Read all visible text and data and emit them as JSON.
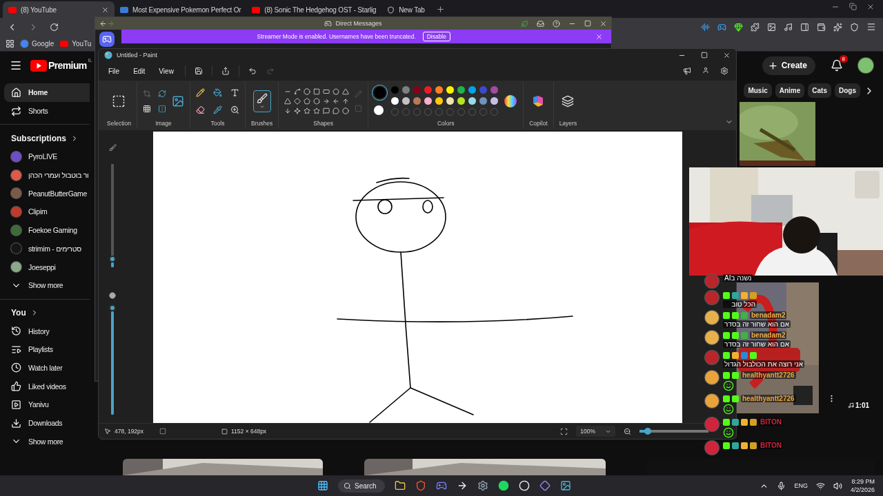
{
  "browser": {
    "tabs": [
      {
        "title": "(8) YouTube",
        "selected": true
      },
      {
        "title": "Most Expensive Pokemon Perfect Or",
        "selected": false
      },
      {
        "title": "(8) Sonic The Hedgehog OST - Starlig",
        "selected": false
      },
      {
        "title": "New Tab",
        "selected": false
      }
    ],
    "bookmarks": [
      "Google",
      "YouTu"
    ]
  },
  "youtube": {
    "logo": "Premium",
    "country": "IL",
    "create": "Create",
    "notifications": "8",
    "nav": [
      {
        "label": "Home",
        "selected": true
      },
      {
        "label": "Shorts",
        "selected": false
      }
    ],
    "subscriptions_title": "Subscriptions",
    "subscriptions": [
      {
        "name": "PyroLIVE",
        "color": "#6b4fc8"
      },
      {
        "name": "ור בוטבול ועמרי הכהן",
        "color": "#e0584a"
      },
      {
        "name": "PeanutButterGame",
        "color": "#7a5a48"
      },
      {
        "name": "Clipim",
        "color": "#c0392b"
      },
      {
        "name": "Foekoe Gaming",
        "color": "#3d6b3a"
      },
      {
        "name": "סטרימים - strimim",
        "color": "#161616"
      },
      {
        "name": "Joeseppi",
        "color": "#8aa88a"
      }
    ],
    "subscriptions_more": "Show more",
    "you_title": "You",
    "you": [
      "History",
      "Playlists",
      "Watch later",
      "Liked videos",
      "Yanivu",
      "Downloads"
    ],
    "you_more": "Show more",
    "chips": [
      "Music",
      "Anime",
      "Cats",
      "Dogs"
    ],
    "duration": "1:01"
  },
  "discord": {
    "title": "Direct Messages",
    "banner": "Streamer Mode is enabled. Usernames have been truncated.",
    "banner_button": "Disable"
  },
  "paint": {
    "title": "Untitled - Paint",
    "menu": [
      "File",
      "Edit",
      "View"
    ],
    "groups": {
      "selection": "Selection",
      "image": "Image",
      "tools": "Tools",
      "brushes": "Brushes",
      "shapes": "Shapes",
      "colors": "Colors",
      "copilot": "Copilot",
      "layers": "Layers"
    },
    "current_colors": [
      {
        "color": "#000000",
        "selected": true
      },
      {
        "color": "#ffffff",
        "selected": false
      }
    ],
    "colors": [
      {
        "color": "#000000"
      },
      {
        "color": "#7f7f7f"
      },
      {
        "color": "#880015"
      },
      {
        "color": "#ed1c24"
      },
      {
        "color": "#ff7f27"
      },
      {
        "color": "#fff200"
      },
      {
        "color": "#22b14c"
      },
      {
        "color": "#00a2e8"
      },
      {
        "color": "#3f48cc"
      },
      {
        "color": "#a349a4"
      },
      {
        "color": "#ffffff"
      },
      {
        "color": "#c3c3c3"
      },
      {
        "color": "#b97a57"
      },
      {
        "color": "#ffaec9"
      },
      {
        "color": "#ffc90e"
      },
      {
        "color": "#efe4b0"
      },
      {
        "color": "#b5e61d"
      },
      {
        "color": "#99d9ea"
      },
      {
        "color": "#7092be"
      },
      {
        "color": "#c8bfe7"
      }
    ],
    "brush_size": {
      "level": 0.05
    },
    "opacity": {
      "level": 1
    },
    "status": {
      "cursor": "478, 192px",
      "canvas_size": "1152 × 648px",
      "zoom": "100%",
      "zoom_slider": {
        "level": 0.12
      }
    }
  },
  "chat": [
    {
      "kind": "text",
      "text": "נשנה בAI"
    },
    {
      "kind": "text",
      "badges": [
        {
          "kind": "kick"
        },
        {
          "kind": "mod"
        },
        {
          "kind": "crown"
        },
        {
          "kind": "coin"
        }
      ],
      "text": "הכל טוב"
    },
    {
      "kind": "text",
      "badges": [
        {
          "kind": "kick"
        },
        {
          "kind": "diamond"
        },
        {
          "kind": "hat"
        }
      ],
      "user": "benadam2",
      "color": "#e8b04a",
      "text": "אם הוא שחור זה בסדר"
    },
    {
      "kind": "text",
      "badges": [
        {
          "kind": "kick"
        },
        {
          "kind": "diamond"
        },
        {
          "kind": "hat"
        }
      ],
      "user": "benadam2",
      "color": "#e8b04a",
      "text": "אם הוא שחור זה בסדר"
    },
    {
      "kind": "text",
      "badges": [
        {
          "kind": "kick"
        },
        {
          "kind": "crown"
        },
        {
          "kind": "gg"
        },
        {
          "kind": "diamond"
        }
      ],
      "text": "אני רוצה את הכולבול הגדול"
    },
    {
      "kind": "emote",
      "badges": [
        {
          "kind": "kick"
        },
        {
          "kind": "diamond"
        }
      ],
      "user": "healthyantt2726",
      "color": "#e8a33c"
    },
    {
      "kind": "emote",
      "badges": [
        {
          "kind": "kick"
        },
        {
          "kind": "diamond"
        }
      ],
      "user": "healthyantt2726",
      "color": "#e8a33c"
    },
    {
      "kind": "emote",
      "badges": [
        {
          "kind": "kick"
        },
        {
          "kind": "mod"
        },
        {
          "kind": "crown"
        },
        {
          "kind": "coin"
        }
      ],
      "user": "BITON",
      "color": "#d0243c"
    },
    {
      "kind": "text",
      "badges": [
        {
          "kind": "kick"
        },
        {
          "kind": "mod"
        },
        {
          "kind": "crown"
        },
        {
          "kind": "coin"
        }
      ],
      "user": "BITON",
      "color": "#d0243c"
    }
  ],
  "taskbar": {
    "search": "Search",
    "language": "ENG",
    "time": "8:29 PM",
    "date": "4/2/2026"
  }
}
